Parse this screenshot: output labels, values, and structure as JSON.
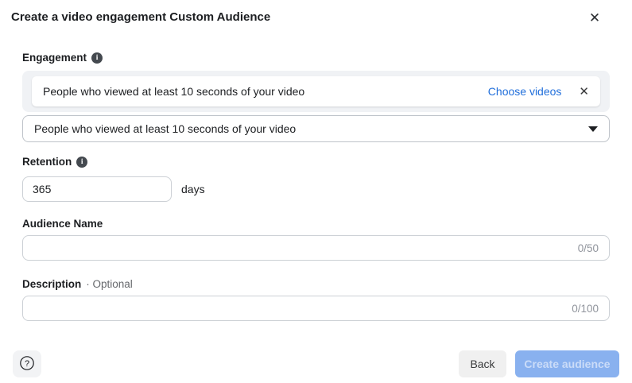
{
  "dialog": {
    "title": "Create a video engagement Custom Audience",
    "close_icon": "✕"
  },
  "engagement": {
    "label": "Engagement",
    "selected_row": {
      "text": "People who viewed at least 10 seconds of your video",
      "choose_videos_label": "Choose videos",
      "remove_icon": "✕"
    },
    "dropdown_value": "People who viewed at least 10 seconds of your video"
  },
  "retention": {
    "label": "Retention",
    "value": "365",
    "unit": "days"
  },
  "audience_name": {
    "label": "Audience Name",
    "value": "",
    "counter": "0/50"
  },
  "description": {
    "label": "Description",
    "optional_label": "· Optional",
    "value": "",
    "counter": "0/100"
  },
  "footer": {
    "back_label": "Back",
    "create_label": "Create audience"
  },
  "colors": {
    "link_blue": "#216fdb",
    "group_background": "#f0f2f5",
    "disabled_button_bg": "#89b1ef",
    "disabled_button_text": "#cbdcf8"
  }
}
